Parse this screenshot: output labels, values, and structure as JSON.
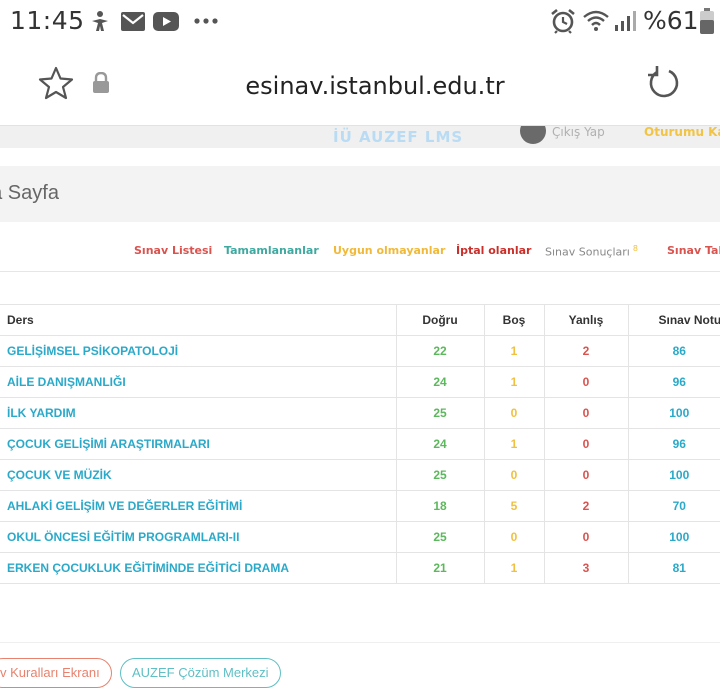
{
  "status_bar": {
    "time": "11:45",
    "battery_text": "%61",
    "icons": [
      "accessibility-icon",
      "mail-icon",
      "youtube-icon",
      "more-dots-icon",
      "alarm-icon",
      "wifi-icon",
      "signal-icon",
      "battery-icon"
    ]
  },
  "browser": {
    "url": "esinav.istanbul.edu.tr",
    "icons": [
      "star-icon",
      "lock-icon",
      "reload-icon"
    ]
  },
  "header_strip": {
    "logo_text": "İÜ AUZEF LMS",
    "faded_link": "Çıkış Yap",
    "yellow_link": "Oturumu Kapat"
  },
  "page": {
    "title": "na Sayfa"
  },
  "tabs": [
    {
      "label": "Sınav Listesi",
      "color": "#d9534f"
    },
    {
      "label": "Tamamlananlar",
      "color": "#3fa9a0"
    },
    {
      "label": "Uygun olmayanlar",
      "color": "#f0b93a"
    },
    {
      "label": "İptal olanlar",
      "color": "#c9302c"
    },
    {
      "label": "Sınav Sonuçları",
      "color": "#888888",
      "badge": "8"
    },
    {
      "label": "Sınav Tak",
      "color": "#d9534f"
    }
  ],
  "table": {
    "headers": {
      "ders": "Ders",
      "dogru": "Doğru",
      "bos": "Boş",
      "yanlis": "Yanlış",
      "not": "Sınav Notu"
    },
    "rows": [
      {
        "ders": "GELİŞİMSEL PSİKOPATOLOJİ",
        "dogru": "22",
        "bos": "1",
        "yanlis": "2",
        "not": "86"
      },
      {
        "ders": "AİLE DANIŞMANLIĞI",
        "dogru": "24",
        "bos": "1",
        "yanlis": "0",
        "not": "96"
      },
      {
        "ders": "İLK YARDIM",
        "dogru": "25",
        "bos": "0",
        "yanlis": "0",
        "not": "100"
      },
      {
        "ders": "ÇOCUK GELİŞİMİ ARAŞTIRMALARI",
        "dogru": "24",
        "bos": "1",
        "yanlis": "0",
        "not": "96"
      },
      {
        "ders": "ÇOCUK VE MÜZİK",
        "dogru": "25",
        "bos": "0",
        "yanlis": "0",
        "not": "100"
      },
      {
        "ders": "AHLAKİ GELİŞİM VE DEĞERLER EĞİTİMİ",
        "dogru": "18",
        "bos": "5",
        "yanlis": "2",
        "not": "70"
      },
      {
        "ders": "OKUL ÖNCESİ EĞİTİM PROGRAMLARI-II",
        "dogru": "25",
        "bos": "0",
        "yanlis": "0",
        "not": "100"
      },
      {
        "ders": "ERKEN ÇOCUKLUK EĞİTİMİNDE EĞİTİCİ DRAMA",
        "dogru": "21",
        "bos": "1",
        "yanlis": "3",
        "not": "81"
      }
    ],
    "colors": {
      "ders": "#2aa9c9",
      "dogru": "#5cb85c",
      "bos": "#f0c040",
      "yanlis": "#d9534f",
      "not": "#2aa9c9"
    }
  },
  "footer": {
    "rules_button": "v Kuralları Ekranı",
    "rules_color": "#e8826e",
    "support_button": "AUZEF Çözüm Merkezi",
    "support_color": "#5fbfc4"
  }
}
